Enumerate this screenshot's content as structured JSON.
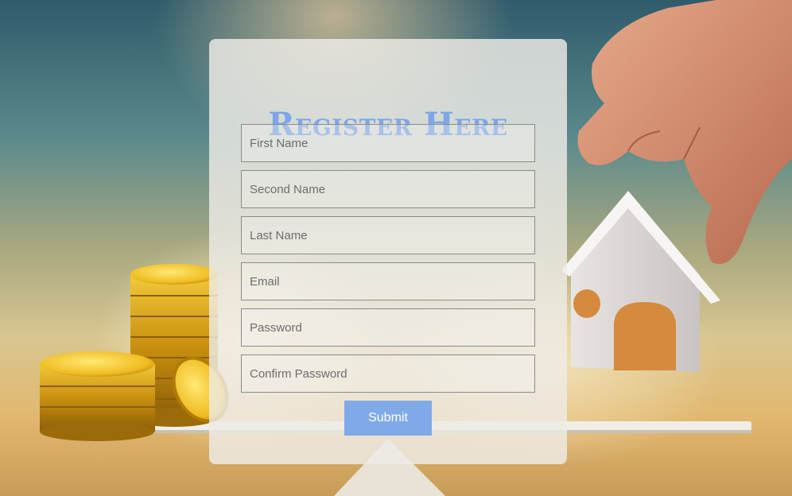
{
  "form": {
    "title": "Register Here",
    "fields": [
      {
        "placeholder": "First Name",
        "value": ""
      },
      {
        "placeholder": "Second Name",
        "value": ""
      },
      {
        "placeholder": "Last Name",
        "value": ""
      },
      {
        "placeholder": "Email",
        "value": ""
      },
      {
        "placeholder": "Password",
        "value": ""
      },
      {
        "placeholder": "Confirm Password",
        "value": ""
      }
    ],
    "submit_label": "Submit"
  },
  "background": {
    "subject": "coins-and-house-on-balance-scale"
  },
  "colors": {
    "accent": "#7faae7",
    "title": "#7da6e6",
    "card": "#eeece6"
  }
}
